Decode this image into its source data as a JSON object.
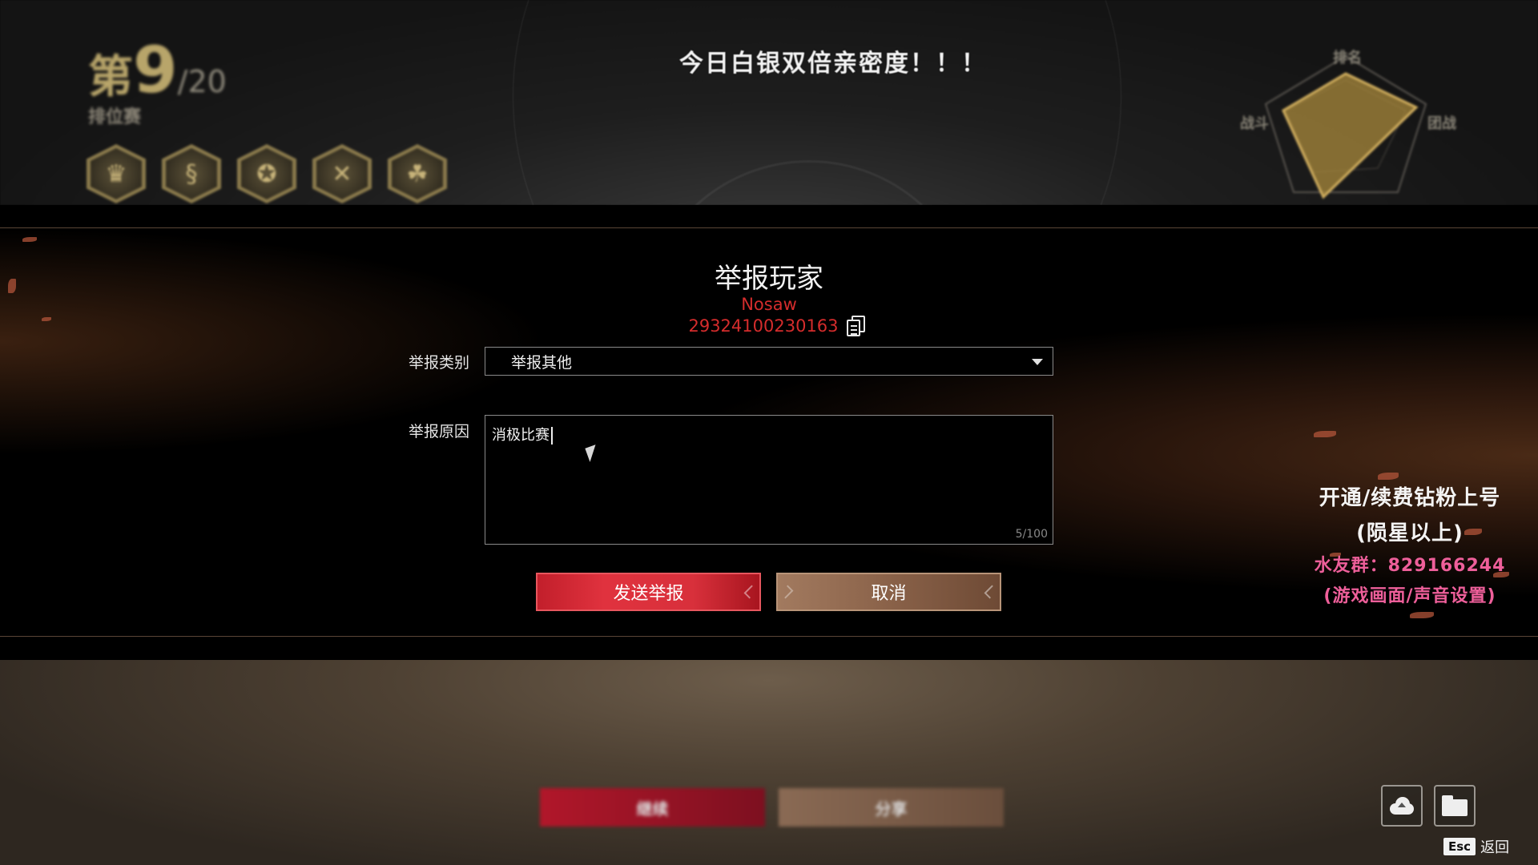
{
  "top": {
    "rank_prefix": "第",
    "rank_number": "9",
    "rank_total": "/20",
    "mode": "排位赛",
    "banner": "今日白银双倍亲密度！！！",
    "radar_labels": [
      "排名",
      "战斗",
      "团战"
    ],
    "badges": [
      "♛",
      "§",
      "✪",
      "✕",
      "☘"
    ]
  },
  "dialog": {
    "title": "举报玩家",
    "player_name": "Nosaw",
    "player_id": "29324100230163",
    "category_label": "举报类别",
    "category_value": "举报其他",
    "reason_label": "举报原因",
    "reason_value": "消极比赛",
    "counter": "5/100",
    "send_label": "发送举报",
    "cancel_label": "取消"
  },
  "promo": {
    "line1": "开通/续费钻粉上号",
    "line2": "(陨星以上)",
    "line3": "水友群：829166244",
    "line4": "(游戏画面/声音设置)"
  },
  "bottom": {
    "continue_label": "继续",
    "share_label": "分享",
    "esc_key": "Esc",
    "esc_label": "返回"
  }
}
